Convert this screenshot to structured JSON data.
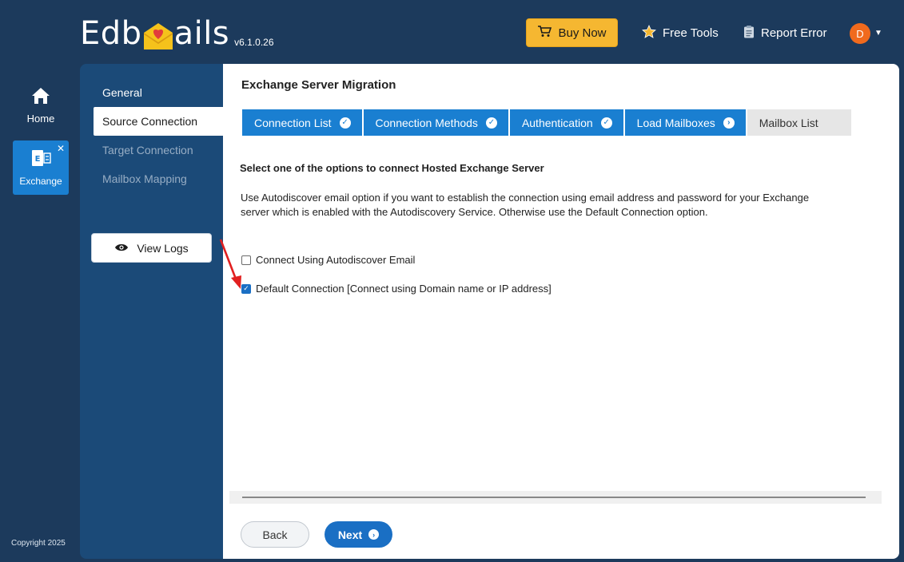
{
  "header": {
    "logo_left": "Edb",
    "logo_right": "ails",
    "version": "v6.1.0.26",
    "buy_label": "Buy Now",
    "free_tools_label": "Free Tools",
    "report_error_label": "Report Error",
    "avatar_letter": "D"
  },
  "rail": {
    "home_label": "Home",
    "exchange_label": "Exchange",
    "copyright": "Copyright 2025"
  },
  "steps": {
    "items": [
      {
        "label": "General"
      },
      {
        "label": "Source Connection"
      },
      {
        "label": "Target Connection"
      },
      {
        "label": "Mailbox Mapping"
      }
    ],
    "view_logs_label": "View Logs"
  },
  "main": {
    "title": "Exchange Server Migration",
    "tabs": [
      {
        "label": "Connection List",
        "state": "done"
      },
      {
        "label": "Connection Methods",
        "state": "done"
      },
      {
        "label": "Authentication",
        "state": "done"
      },
      {
        "label": "Load Mailboxes",
        "state": "current"
      },
      {
        "label": "Mailbox List",
        "state": "pending"
      }
    ],
    "subheading": "Select one of the options to connect Hosted Exchange Server",
    "description": "Use Autodiscover email option if you want to establish the connection using email address and password for your Exchange server which is enabled with the Autodiscovery Service. Otherwise use the Default Connection option.",
    "options": [
      {
        "label": "Connect Using Autodiscover Email",
        "checked": false
      },
      {
        "label": "Default Connection [Connect using Domain name or IP address]",
        "checked": true
      }
    ],
    "back_label": "Back",
    "next_label": "Next"
  },
  "colors": {
    "background": "#1c3a5c",
    "panel": "#1b4a78",
    "accent": "#1a7fd1",
    "buy": "#f5b731",
    "avatar": "#f06a1d"
  }
}
